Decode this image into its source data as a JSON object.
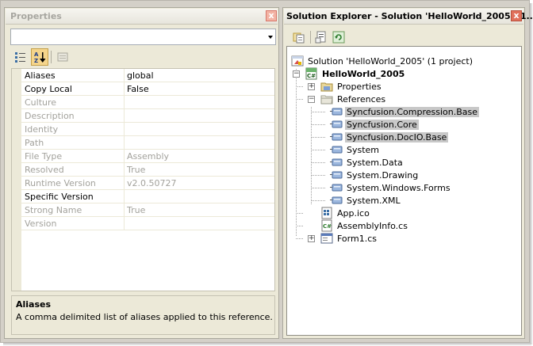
{
  "properties_panel": {
    "title": "Properties",
    "close_glyph": "x",
    "combo_value": "",
    "toolbar": {
      "categorized_icon": "categorized-icon",
      "alphabetical_icon": "alphabetical-sort-icon",
      "property_pages_icon": "property-pages-icon"
    },
    "rows": [
      {
        "name": "Aliases",
        "value": "global",
        "enabled": true
      },
      {
        "name": "Copy Local",
        "value": "False",
        "enabled": true
      },
      {
        "name": "Culture",
        "value": "",
        "enabled": false
      },
      {
        "name": "Description",
        "value": "",
        "enabled": false
      },
      {
        "name": "Identity",
        "value": "",
        "enabled": false
      },
      {
        "name": "Path",
        "value": "",
        "enabled": false
      },
      {
        "name": "File Type",
        "value": "Assembly",
        "enabled": false
      },
      {
        "name": "Resolved",
        "value": "True",
        "enabled": false
      },
      {
        "name": "Runtime Version",
        "value": "v2.0.50727",
        "enabled": false
      },
      {
        "name": "Specific Version",
        "value": "",
        "enabled": true
      },
      {
        "name": "Strong Name",
        "value": "True",
        "enabled": false
      },
      {
        "name": "Version",
        "value": "",
        "enabled": false
      }
    ],
    "description": {
      "title": "Aliases",
      "text": "A comma delimited list of aliases applied to this reference."
    }
  },
  "solution_explorer": {
    "title": "Solution Explorer - Solution 'HelloWorld_2005' (1...",
    "close_glyph": "x",
    "toolbar": {
      "show_all_files_icon": "show-all-files-icon",
      "properties_icon": "properties-icon",
      "refresh_icon": "refresh-icon"
    },
    "tree": {
      "solution": "Solution 'HelloWorld_2005' (1 project)",
      "project": "HelloWorld_2005",
      "properties": "Properties",
      "references": "References",
      "reference_items": [
        {
          "label": "Syncfusion.Compression.Base",
          "highlighted": true
        },
        {
          "label": "Syncfusion.Core",
          "highlighted": true
        },
        {
          "label": "Syncfusion.DocIO.Base",
          "highlighted": true
        },
        {
          "label": "System",
          "highlighted": false
        },
        {
          "label": "System.Data",
          "highlighted": false
        },
        {
          "label": "System.Drawing",
          "highlighted": false
        },
        {
          "label": "System.Windows.Forms",
          "highlighted": false
        },
        {
          "label": "System.XML",
          "highlighted": false
        }
      ],
      "files": [
        "App.ico",
        "AssemblyInfo.cs",
        "Form1.cs"
      ],
      "expander_plus": "+",
      "expander_minus": "−"
    }
  }
}
